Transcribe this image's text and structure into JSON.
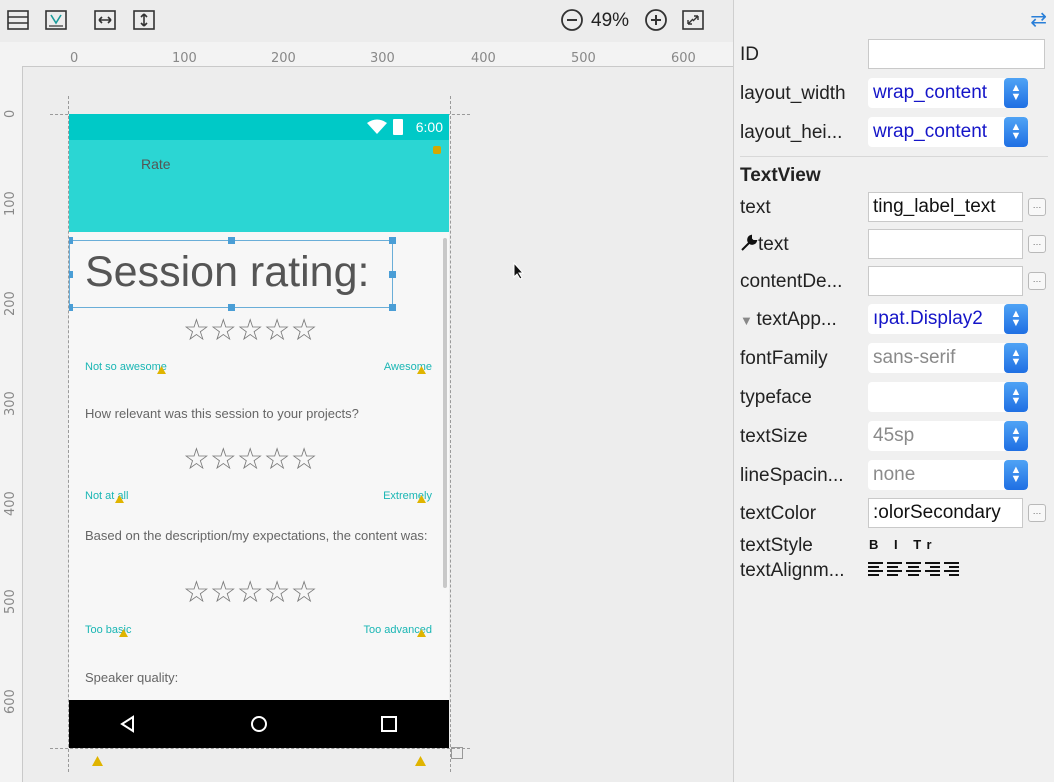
{
  "toolbar": {
    "zoom_level": "49%",
    "icons": [
      "layout-icon",
      "blueprint-icon",
      "expand-horizontal-icon",
      "expand-vertical-icon",
      "zoom-out-icon",
      "zoom-in-icon",
      "fit-screen-icon"
    ]
  },
  "ruler": {
    "horizontal": [
      "0",
      "100",
      "200",
      "300",
      "400",
      "500",
      "600"
    ],
    "vertical": [
      "0",
      "100",
      "200",
      "300",
      "400",
      "500",
      "600"
    ]
  },
  "device": {
    "status_time": "6:00",
    "appbar_title": "Rate",
    "session_title": "Session rating:",
    "rating_groups": [
      {
        "left": "Not so awesome",
        "right": "Awesome"
      },
      {
        "question": "How relevant was this session to your projects?",
        "left": "Not at all",
        "right": "Extremely"
      },
      {
        "question": "Based on the description/my expectations, the content was:",
        "left": "Too basic",
        "right": "Too advanced"
      }
    ],
    "speaker_question": "Speaker quality:",
    "star_glyph": "☆☆☆☆☆",
    "colors": {
      "status_bar": "#00c9c7",
      "app_bar": "#2bd6d3",
      "accent_text": "#1ab6b4"
    }
  },
  "properties": {
    "id": {
      "label": "ID",
      "value": ""
    },
    "layout_width": {
      "label": "layout_width",
      "value": "wrap_content"
    },
    "layout_height": {
      "label": "layout_hei...",
      "value": "wrap_content"
    },
    "section": "TextView",
    "text": {
      "label": "text",
      "value": "ting_label_text"
    },
    "tools_text": {
      "label": "text",
      "value": ""
    },
    "content_description": {
      "label": "contentDe...",
      "value": ""
    },
    "text_appearance": {
      "label": "textApp...",
      "value": "ıpat.Display2"
    },
    "font_family": {
      "label": "fontFamily",
      "value": "sans-serif"
    },
    "typeface": {
      "label": "typeface",
      "value": ""
    },
    "text_size": {
      "label": "textSize",
      "value": "45sp"
    },
    "line_spacing": {
      "label": "lineSpacin...",
      "value": "none"
    },
    "text_color": {
      "label": "textColor",
      "value": ":olorSecondary"
    },
    "text_style": {
      "label": "textStyle",
      "buttons": "B I Tr"
    },
    "text_alignment": {
      "label": "textAlignm..."
    }
  }
}
